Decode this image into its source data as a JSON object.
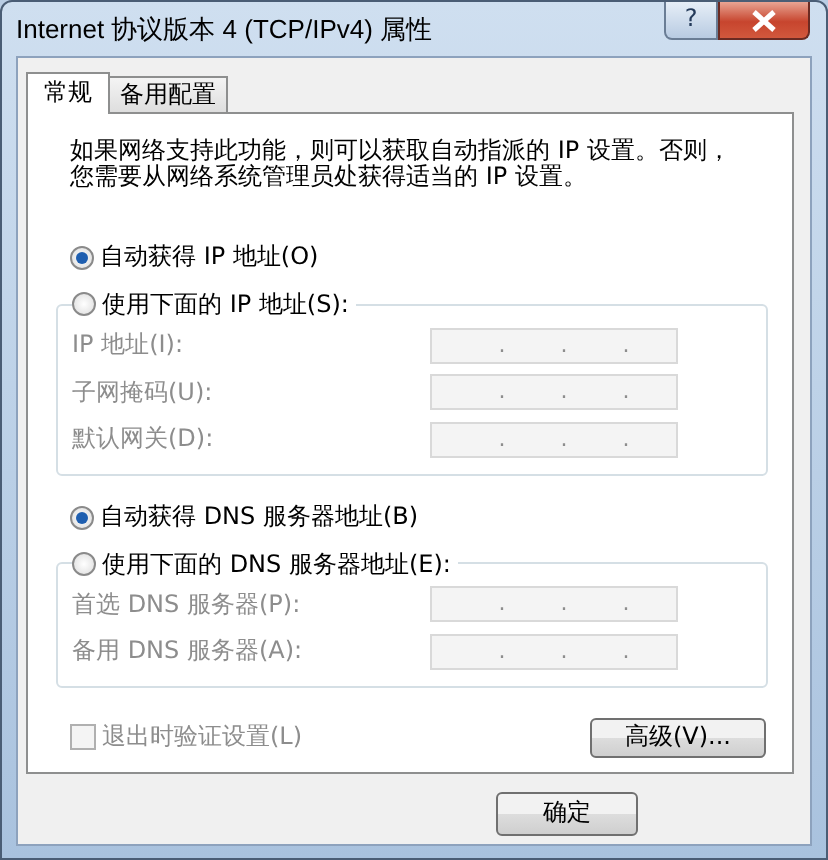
{
  "window": {
    "title": "Internet 协议版本 4 (TCP/IPv4) 属性",
    "help_label": "?"
  },
  "tabs": [
    {
      "label": "常规",
      "selected": true
    },
    {
      "label": "备用配置",
      "selected": false
    }
  ],
  "description": [
    "如果网络支持此功能，则可以获取自动指派的 IP 设置。否则，",
    "您需要从网络系统管理员处获得适当的 IP 设置。"
  ],
  "sections": [
    {
      "auto": {
        "label": "自动获得 IP 地址(O)",
        "selected": true
      },
      "manual": {
        "label": "使用下面的 IP 地址(S):",
        "selected": false
      },
      "fields": [
        {
          "label": "IP 地址(I):",
          "value": ". . .",
          "disabled": true
        },
        {
          "label": "子网掩码(U):",
          "value": ". . .",
          "disabled": true
        },
        {
          "label": "默认网关(D):",
          "value": ". . .",
          "disabled": true
        }
      ]
    },
    {
      "auto": {
        "label": "自动获得 DNS 服务器地址(B)",
        "selected": true
      },
      "manual": {
        "label": "使用下面的 DNS 服务器地址(E):",
        "selected": false
      },
      "fields": [
        {
          "label": "首选 DNS 服务器(P):",
          "value": ". . .",
          "disabled": true
        },
        {
          "label": "备用 DNS 服务器(A):",
          "value": ". . .",
          "disabled": true
        }
      ]
    }
  ],
  "validate": {
    "label": "退出时验证设置(L)",
    "checked": false,
    "disabled": true
  },
  "advanced_button": "高级(V)...",
  "ok_button": "确定"
}
